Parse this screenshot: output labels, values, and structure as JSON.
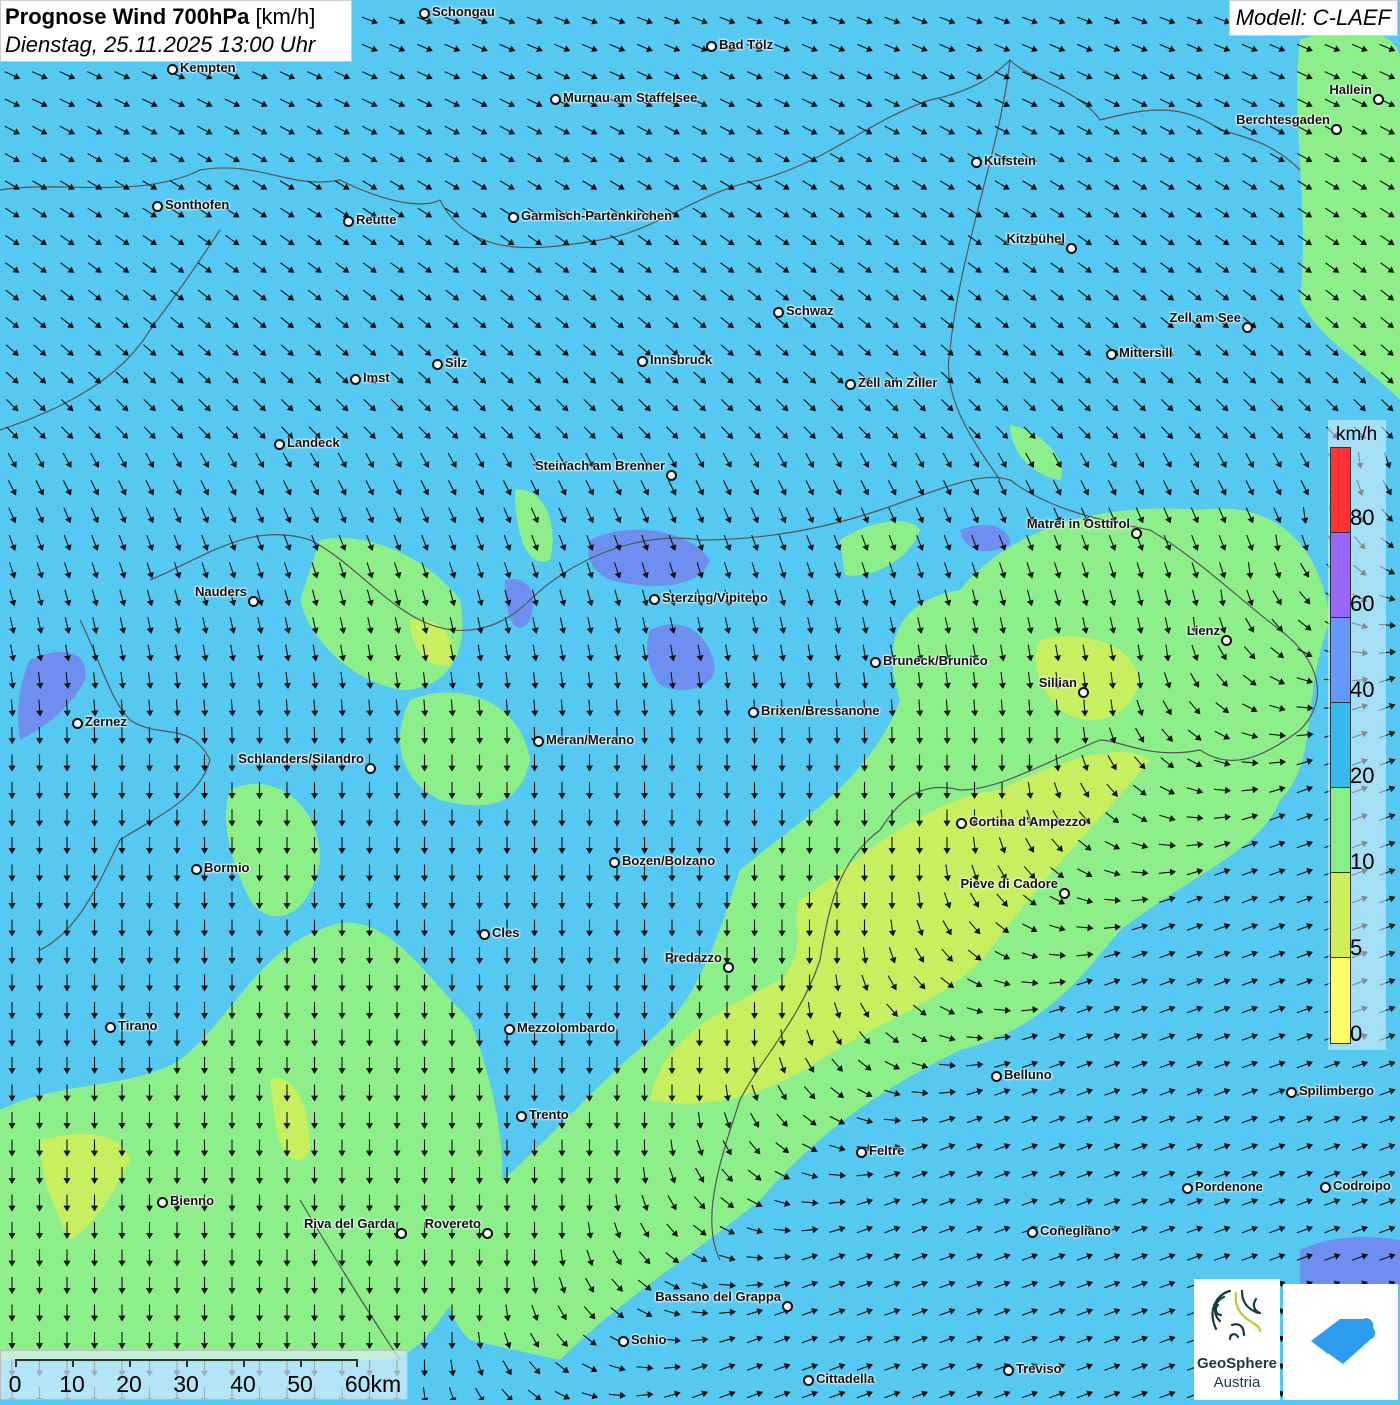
{
  "header": {
    "title": "Prognose Wind 700hPa",
    "unit": "[km/h]",
    "datetime": "Dienstag, 25.11.2025 13:00 Uhr",
    "model": "Modell: C-LAEF"
  },
  "legend": {
    "unit": "km/h",
    "labels": [
      "80",
      "60",
      "40",
      "20",
      "10",
      "5",
      "0"
    ],
    "colors": [
      "#ff3333",
      "#9966ff",
      "#6699ff",
      "#33bbee",
      "#88ee88",
      "#ccf055",
      "#ffff66"
    ]
  },
  "scale_bar": {
    "labels": [
      "0",
      "10",
      "20",
      "30",
      "40",
      "50",
      "60km"
    ]
  },
  "logos": {
    "geosphere_line1": "GeoSphere",
    "geosphere_line2": "Austria",
    "second_logo_icon": "house-cloud-icon"
  },
  "colors": {
    "calm_0_5": "#ffff66",
    "5_10": "#ccf055",
    "10_20": "#8cef8a",
    "20_40": "#56c9f2",
    "40_60": "#6f8ff0",
    "arrow": "#111111",
    "borders": "#555555"
  },
  "cities": [
    "Schongau",
    "Bad Tölz",
    "Kempten",
    "Murnau am Staffelsee",
    "Hallein",
    "Berchtesgaden",
    "Kufstein",
    "Sonthofen",
    "Reutte",
    "Garmisch-Partenkirchen",
    "Kitzbühel",
    "Schwaz",
    "Zell am See",
    "Mittersill",
    "Innsbruck",
    "Silz",
    "Imst",
    "Zell am Ziller",
    "Landeck",
    "Steinach am Brenner",
    "Matrei in Osttirol",
    "Nauders",
    "Sterzing/Vipiteno",
    "Lienz",
    "Bruneck/Brunico",
    "Sillian",
    "Brixen/Bressanone",
    "Zernez",
    "Meran/Merano",
    "Schlanders/Silandro",
    "Cortina d'Ampezzo",
    "Bozen/Bolzano",
    "Bormio",
    "Pieve di Cadore",
    "Cles",
    "Predazzo",
    "Tirano",
    "Mezzolombardo",
    "Belluno",
    "Spilimbergo",
    "Trento",
    "Feltre",
    "Pordenone",
    "Codroipo",
    "Bienno",
    "Riva del Garda",
    "Rovereto",
    "Conegliano",
    "Bassano del Grappa",
    "Schio",
    "Treviso",
    "Cittadella"
  ]
}
